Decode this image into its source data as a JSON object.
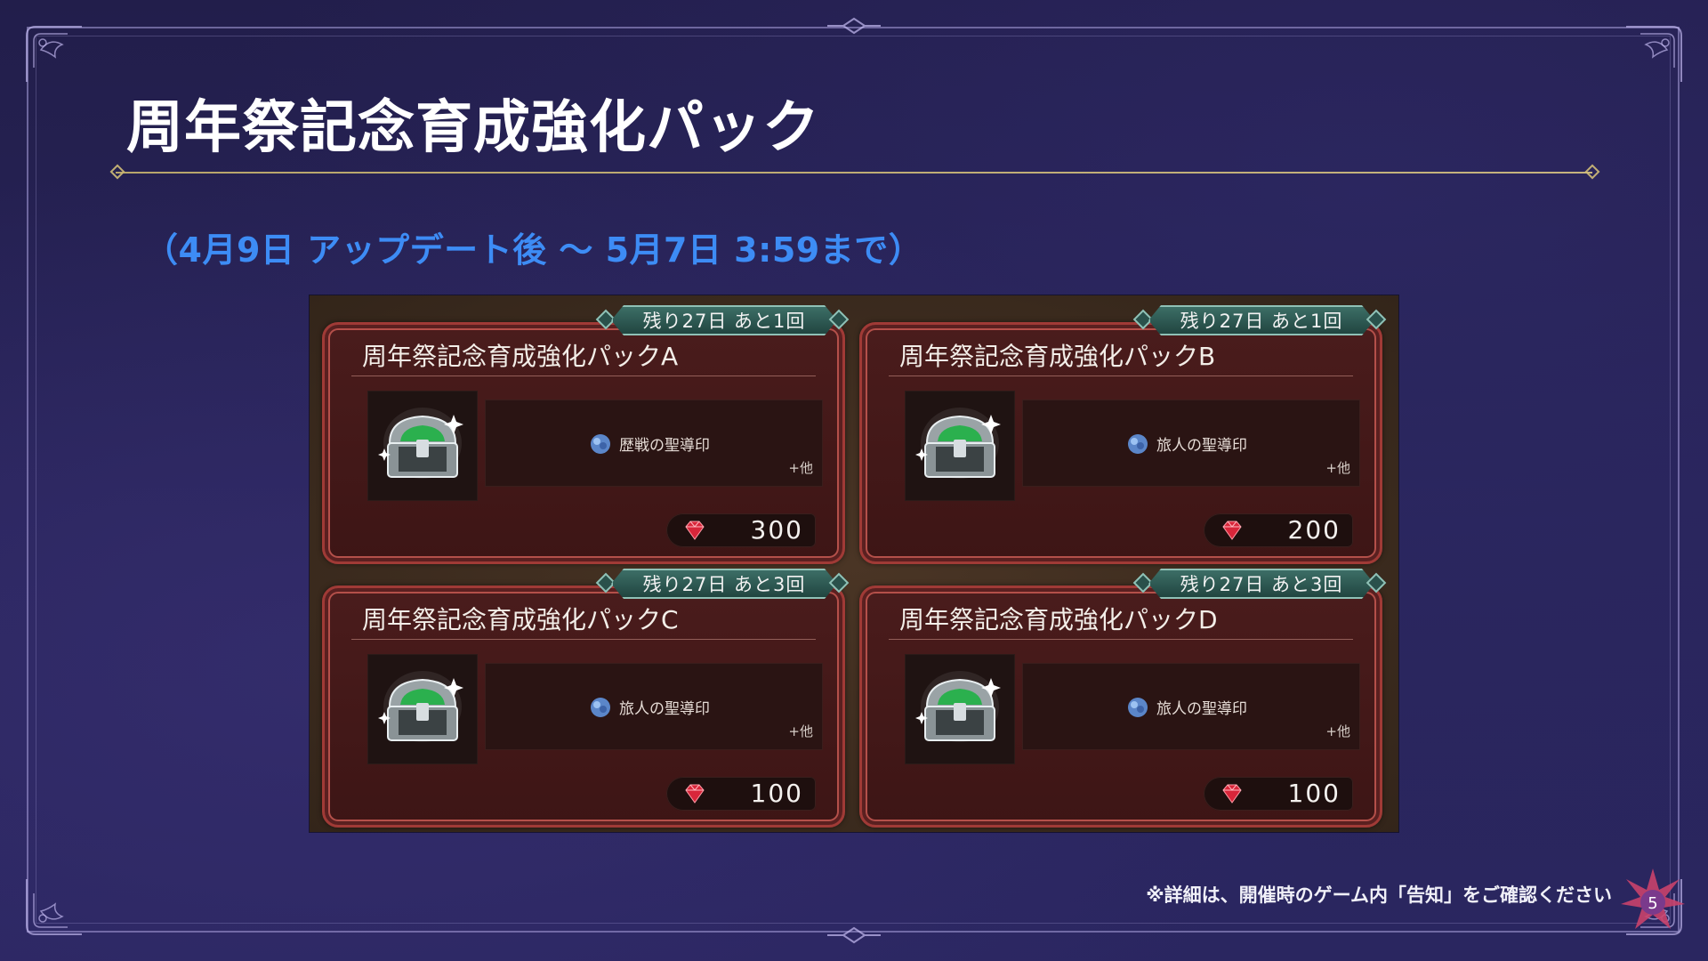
{
  "page": {
    "title": "周年祭記念育成強化パック",
    "period": "（4月9日 アップデート後 〜 5月7日 3:59まで）",
    "footnote": "※詳細は、開催時のゲーム内「告知」をご確認ください",
    "page_number": "5"
  },
  "packs": [
    {
      "title": "周年祭記念育成強化パックA",
      "remaining": "残り27日 あと1回",
      "item": "歴戦の聖導印",
      "more": "+他",
      "price": "300",
      "icon": "treasure-chest-icon"
    },
    {
      "title": "周年祭記念育成強化パックB",
      "remaining": "残り27日 あと1回",
      "item": "旅人の聖導印",
      "more": "+他",
      "price": "200",
      "icon": "treasure-chest-icon"
    },
    {
      "title": "周年祭記念育成強化パックC",
      "remaining": "残り27日 あと3回",
      "item": "旅人の聖導印",
      "more": "+他",
      "price": "100",
      "icon": "treasure-chest-icon"
    },
    {
      "title": "周年祭記念育成強化パックD",
      "remaining": "残り27日 あと3回",
      "item": "旅人の聖導印",
      "more": "+他",
      "price": "100",
      "icon": "treasure-chest-icon"
    }
  ],
  "colors": {
    "background": "#231f4d",
    "period_text": "#3d8cf5",
    "pack_border": "#a03a36",
    "remain_badge": "#3c6e66"
  }
}
